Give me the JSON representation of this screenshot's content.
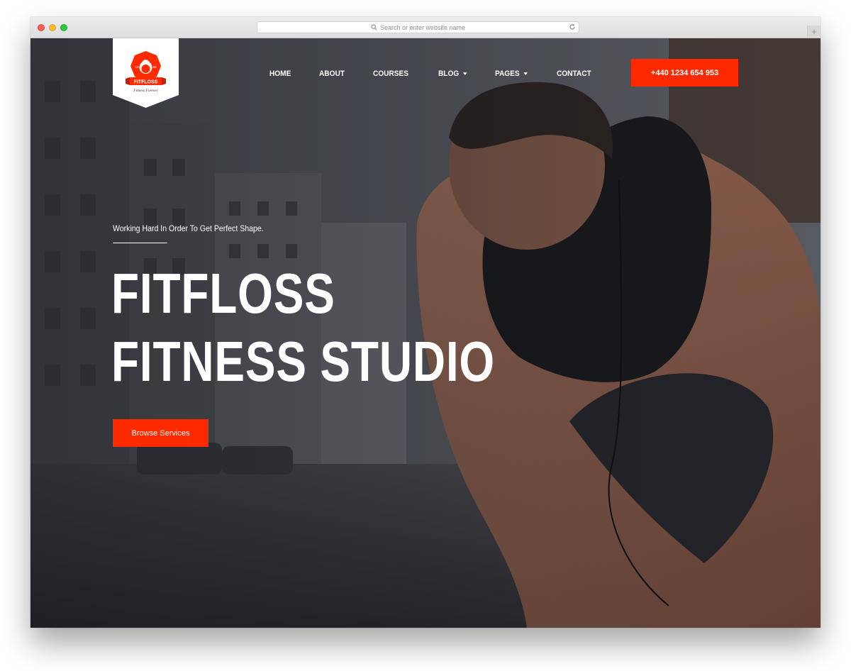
{
  "browser": {
    "url_placeholder": "Search or enter website name",
    "new_tab_label": "+"
  },
  "logo": {
    "name": "FITFLOSS",
    "est_left": "19",
    "est_right": "85",
    "subtitle": "Fitness Forever"
  },
  "nav": {
    "items": [
      {
        "label": "HOME",
        "dropdown": false
      },
      {
        "label": "ABOUT",
        "dropdown": false
      },
      {
        "label": "COURSES",
        "dropdown": false
      },
      {
        "label": "BLOG",
        "dropdown": true
      },
      {
        "label": "PAGES",
        "dropdown": true
      },
      {
        "label": "CONTACT",
        "dropdown": false
      }
    ],
    "phone": "+440 1234 654 953"
  },
  "hero": {
    "tagline": "Working Hard In Order To Get Perfect Shape.",
    "title_line1": "FITFLOSS",
    "title_line2": "FITNESS STUDIO",
    "cta_label": "Browse Services"
  },
  "colors": {
    "accent": "#ff2a00",
    "text": "#ffffff"
  }
}
